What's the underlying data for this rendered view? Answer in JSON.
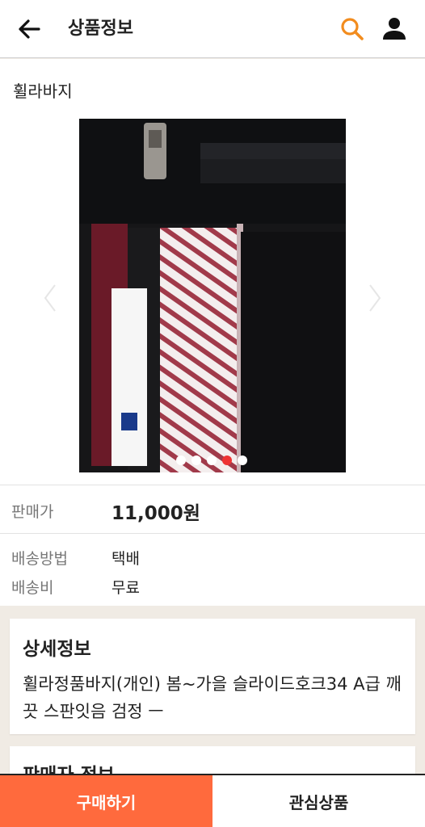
{
  "header": {
    "title": "상품정보",
    "back_icon": "arrow-left-icon",
    "search_icon": "search-icon",
    "user_icon": "user-icon",
    "accent_color": "#f28c1e"
  },
  "product": {
    "name": "휠라바지",
    "image_desc_icon": "product-photo",
    "carousel": {
      "total": 5,
      "active": 4
    }
  },
  "info": {
    "price_label": "판매가",
    "price_value": "11,000원",
    "shipping_method_label": "배송방법",
    "shipping_method_value": "택배",
    "shipping_fee_label": "배송비",
    "shipping_fee_value": "무료"
  },
  "detail": {
    "title": "상세정보",
    "body": "휠라정품바지(개인) 봄~가을 슬라이드호크34 A급 깨끗 스판잇음 검정 ㅡ"
  },
  "seller": {
    "title": "판매자 정보"
  },
  "footer": {
    "buy_label": "구매하기",
    "wish_label": "관심상품",
    "buy_color": "#ff6a3d"
  }
}
